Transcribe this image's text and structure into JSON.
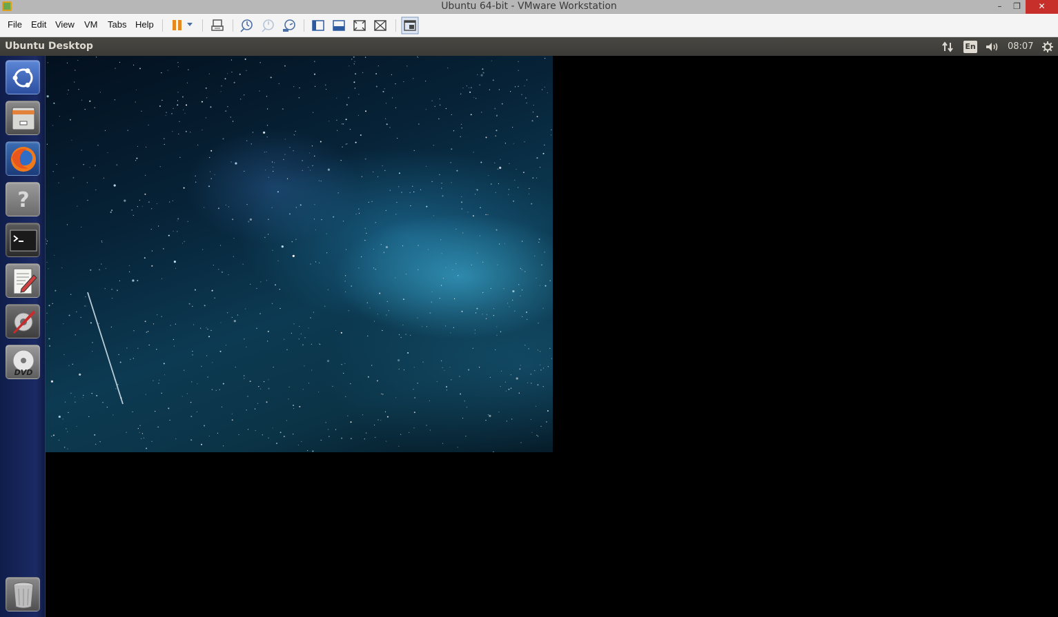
{
  "window": {
    "title": "Ubuntu 64-bit - VMware Workstation",
    "min_glyph": "–",
    "max_glyph": "❐",
    "close_glyph": "✕"
  },
  "menubar": {
    "items": [
      "File",
      "Edit",
      "View",
      "VM",
      "Tabs",
      "Help"
    ]
  },
  "ubuntu_panel": {
    "title": "Ubuntu Desktop",
    "language": "En",
    "clock": "08:07"
  },
  "launcher": {
    "items": [
      {
        "name": "ubuntu-dash",
        "icon": "ubuntu-logo-icon"
      },
      {
        "name": "files",
        "icon": "file-cabinet-icon"
      },
      {
        "name": "firefox",
        "icon": "firefox-icon"
      },
      {
        "name": "help",
        "icon": "question-icon"
      },
      {
        "name": "terminal",
        "icon": "terminal-icon"
      },
      {
        "name": "text-editor",
        "icon": "text-editor-icon"
      },
      {
        "name": "system-settings",
        "icon": "settings-icon"
      },
      {
        "name": "dvd",
        "icon": "dvd-icon",
        "label": "DVD"
      },
      {
        "name": "trash",
        "icon": "trash-icon"
      }
    ]
  },
  "colors": {
    "close_button": "#c7302a",
    "pause_accent": "#e58a1f",
    "launcher_bg": "#1b2a63",
    "panel_bg": "#3b3a36"
  }
}
